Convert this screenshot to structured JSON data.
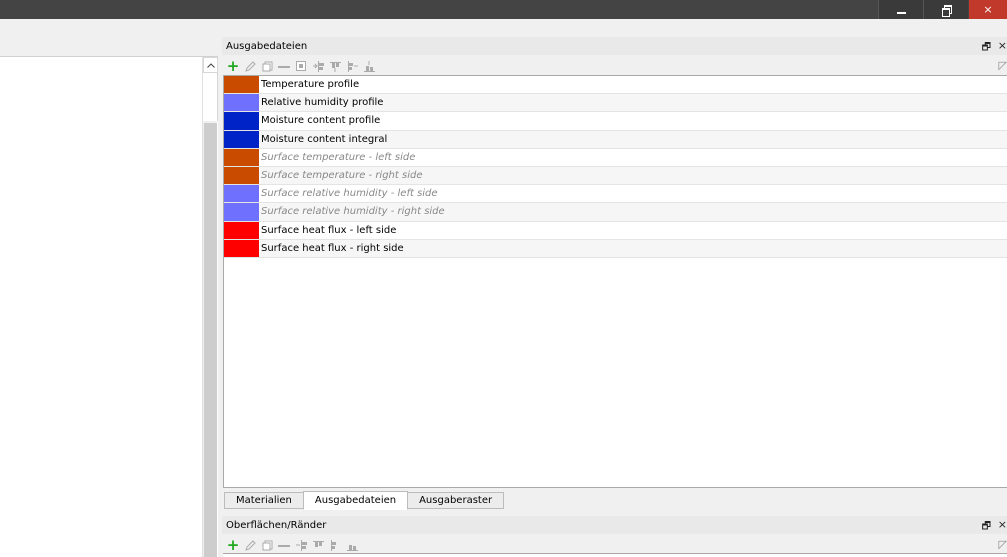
{
  "window": {
    "minimize_glyph": "minimize-icon",
    "restore_glyph": "restore-icon",
    "close_glyph": "×"
  },
  "output_files_dock": {
    "title": "Ausgabedateien",
    "float_glyph": "🗗",
    "close_glyph": "×",
    "toolbar": [
      "add-icon",
      "edit-icon",
      "copy-icon",
      "remove-icon",
      "select-icon",
      "align-left-icon",
      "align-top-icon",
      "align-right-icon",
      "align-bottom-icon"
    ],
    "corner_glyph": "◸",
    "items": [
      {
        "label": "Temperature profile",
        "color": "#c84b00",
        "active": true
      },
      {
        "label": "Relative humidity profile",
        "color": "#7070ff",
        "active": true
      },
      {
        "label": "Moisture content profile",
        "color": "#0023c8",
        "active": true
      },
      {
        "label": "Moisture content integral",
        "color": "#0023c8",
        "active": true
      },
      {
        "label": "Surface temperature - left side",
        "color": "#c84b00",
        "active": false
      },
      {
        "label": "Surface temperature - right side",
        "color": "#c84b00",
        "active": false
      },
      {
        "label": "Surface relative humidity - left side",
        "color": "#7070ff",
        "active": false
      },
      {
        "label": "Surface relative humidity - right side",
        "color": "#7070ff",
        "active": false
      },
      {
        "label": "Surface heat flux - left side",
        "color": "#ff0000",
        "active": true
      },
      {
        "label": "Surface heat flux - right side",
        "color": "#ff0000",
        "active": true
      }
    ]
  },
  "tabs": [
    {
      "label": "Materialien",
      "active": false
    },
    {
      "label": "Ausgabedateien",
      "active": true
    },
    {
      "label": "Ausgaberaster",
      "active": false
    }
  ],
  "surfaces_dock": {
    "title": "Oberflächen/Ränder",
    "float_glyph": "🗗",
    "close_glyph": "×",
    "corner_glyph": "◸"
  }
}
